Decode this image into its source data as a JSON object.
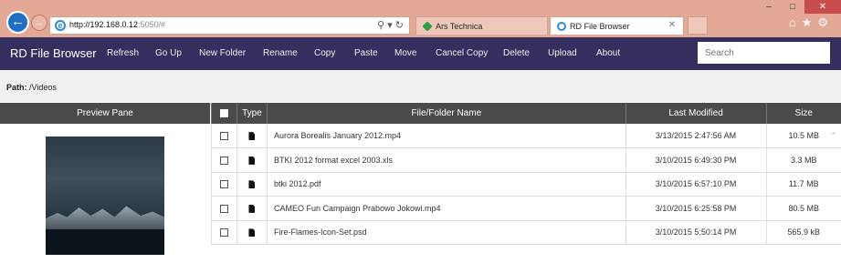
{
  "browser": {
    "url_host": "http://192.168.0.12",
    "url_rest": ":5050/#",
    "tabs": [
      {
        "label": "Ars Technica"
      },
      {
        "label": "RD File Browser"
      }
    ]
  },
  "app": {
    "brand": "RD File Browser",
    "menu": [
      "Refresh",
      "Go Up",
      "New Folder",
      "Rename",
      "Copy",
      "Paste",
      "Move",
      "Cancel Copy",
      "Delete",
      "Upload",
      "About"
    ],
    "search_placeholder": "Search"
  },
  "path": {
    "label": "Path:",
    "value": " /Videos"
  },
  "preview": {
    "header": "Preview Pane"
  },
  "table": {
    "headers": {
      "type": "Type",
      "name": "File/Folder Name",
      "modified": "Last Modified",
      "size": "Size"
    },
    "rows": [
      {
        "name": "Aurora Borealis January 2012.mp4",
        "modified": "3/13/2015 2:47:56 AM",
        "size": "10.5 MB"
      },
      {
        "name": "BTKI 2012 format excel 2003.xls",
        "modified": "3/10/2015 6:49:30 PM",
        "size": "3.3 MB"
      },
      {
        "name": "btki 2012.pdf",
        "modified": "3/10/2015 6:57:10 PM",
        "size": "11.7 MB"
      },
      {
        "name": "CAMEO Fun Campaign Prabowo Jokowi.mp4",
        "modified": "3/10/2015 6:25:58 PM",
        "size": "80.5 MB"
      },
      {
        "name": "Fire-Flames-Icon-Set.psd",
        "modified": "3/10/2015 5:50:14 PM",
        "size": "565.9 kB"
      }
    ]
  },
  "colors": {
    "navbar": "#342f5f",
    "header": "#4a4a4a",
    "chrome": "#e3a896"
  }
}
